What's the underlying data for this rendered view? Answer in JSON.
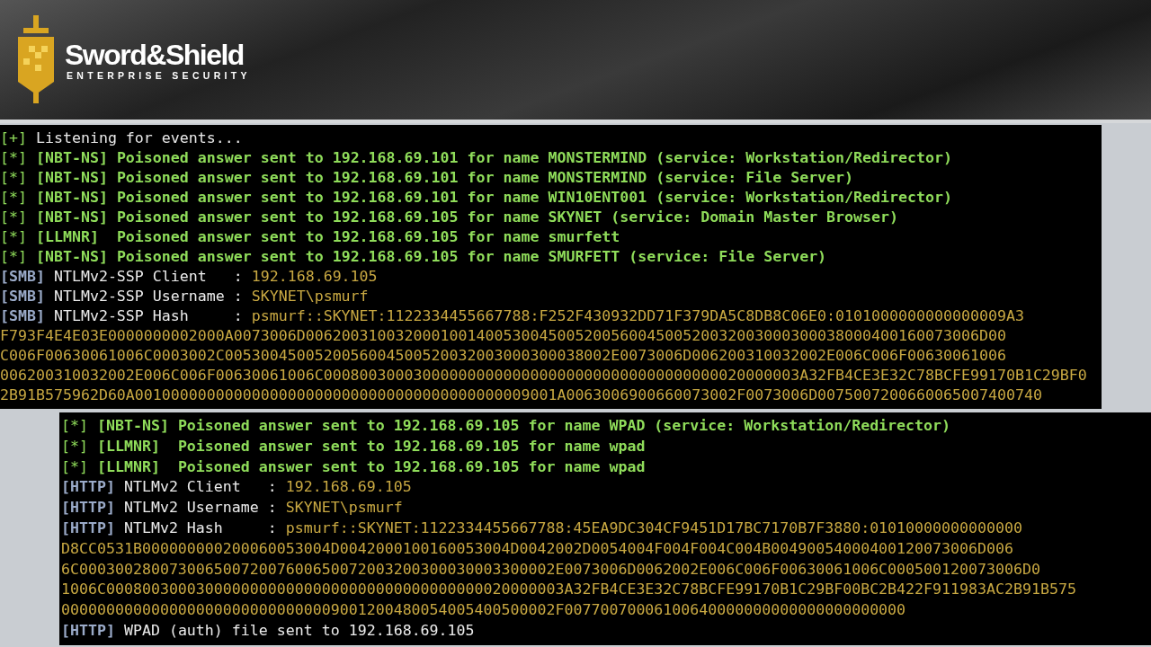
{
  "header": {
    "brand": "Sword&Shield",
    "tagline": "ENTERPRISE SECURITY"
  },
  "terminals": [
    {
      "lines": [
        {
          "kind": "notice",
          "prefix": "[+]",
          "text": "Listening for events..."
        },
        {
          "kind": "event",
          "prefix": "[*]",
          "text": "[NBT-NS] Poisoned answer sent to 192.168.69.101 for name MONSTERMIND (service: Workstation/Redirector)"
        },
        {
          "kind": "event",
          "prefix": "[*]",
          "text": "[NBT-NS] Poisoned answer sent to 192.168.69.101 for name MONSTERMIND (service: File Server)"
        },
        {
          "kind": "event",
          "prefix": "[*]",
          "text": "[NBT-NS] Poisoned answer sent to 192.168.69.101 for name WIN10ENT001 (service: Workstation/Redirector)"
        },
        {
          "kind": "event",
          "prefix": "[*]",
          "text": "[NBT-NS] Poisoned answer sent to 192.168.69.105 for name SKYNET (service: Domain Master Browser)"
        },
        {
          "kind": "event",
          "prefix": "[*]",
          "text": "[LLMNR]  Poisoned answer sent to 192.168.69.105 for name smurfett"
        },
        {
          "kind": "event",
          "prefix": "[*]",
          "text": "[NBT-NS] Poisoned answer sent to 192.168.69.105 for name SMURFETT (service: File Server)"
        },
        {
          "kind": "info",
          "tag": "[SMB]",
          "label": "NTLMv2-SSP Client   :",
          "value": "192.168.69.105"
        },
        {
          "kind": "info",
          "tag": "[SMB]",
          "label": "NTLMv2-SSP Username :",
          "value": "SKYNET\\psmurf"
        },
        {
          "kind": "info",
          "tag": "[SMB]",
          "label": "NTLMv2-SSP Hash     :",
          "value": "psmurf::SKYNET:1122334455667788:F252F430932DD71F379DA5C8DB8C06E0:0101000000000000009A3"
        },
        {
          "kind": "hex",
          "text": "F793F4E4E03E0000000002000A0073006D006200310032000100140053004500520056004500520032003000300038000400160073006D00"
        },
        {
          "kind": "hex",
          "text": "C006F00630061006C0003002C0053004500520056004500520032003000300038002E0073006D006200310032002E006C006F00630061006"
        },
        {
          "kind": "hex",
          "text": "006200310032002E006C006F00630061006C00080030003000000000000000000000000000000000020000003A32FB4CE3E32C78BCFE99170B1C29BF0"
        },
        {
          "kind": "hex",
          "text": "2B91B575962D60A00100000000000000000000000000000000000000009001A0063006900660073002F0073006D0075007200660065007400740"
        }
      ]
    },
    {
      "lines": [
        {
          "kind": "event",
          "prefix": "[*]",
          "text": "[NBT-NS] Poisoned answer sent to 192.168.69.105 for name WPAD (service: Workstation/Redirector)"
        },
        {
          "kind": "event",
          "prefix": "[*]",
          "text": "[LLMNR]  Poisoned answer sent to 192.168.69.105 for name wpad"
        },
        {
          "kind": "event",
          "prefix": "[*]",
          "text": "[LLMNR]  Poisoned answer sent to 192.168.69.105 for name wpad"
        },
        {
          "kind": "info",
          "tag": "[HTTP]",
          "label": "NTLMv2 Client   :",
          "value": "192.168.69.105"
        },
        {
          "kind": "info",
          "tag": "[HTTP]",
          "label": "NTLMv2 Username :",
          "value": "SKYNET\\psmurf"
        },
        {
          "kind": "info",
          "tag": "[HTTP]",
          "label": "NTLMv2 Hash     :",
          "value": "psmurf::SKYNET:1122334455667788:45EA9DC304CF9451D17BC7170B7F3880:01010000000000000"
        },
        {
          "kind": "hex",
          "text": "D8CC0531B000000000200060053004D0042000100160053004D0042002D0054004F004F004C004B00490054000400120073006D006"
        },
        {
          "kind": "hex",
          "text": "6C00030028007300650072007600650072003200300030003300002E0073006D0062002E006C006F00630061006C000500120073006D0"
        },
        {
          "kind": "hex",
          "text": "1006C000800300030000000000000000000000000000000020000003A32FB4CE3E32C78BCFE99170B1C29BF00BC2B422F911983AC2B91B575"
        },
        {
          "kind": "hex",
          "text": "0000000000000000000000000000009001200480054005400500002F00770070006100640000000000000000000000"
        },
        {
          "kind": "note",
          "tag": "[HTTP]",
          "text": "WPAD (auth) file sent to 192.168.69.105"
        }
      ]
    }
  ]
}
